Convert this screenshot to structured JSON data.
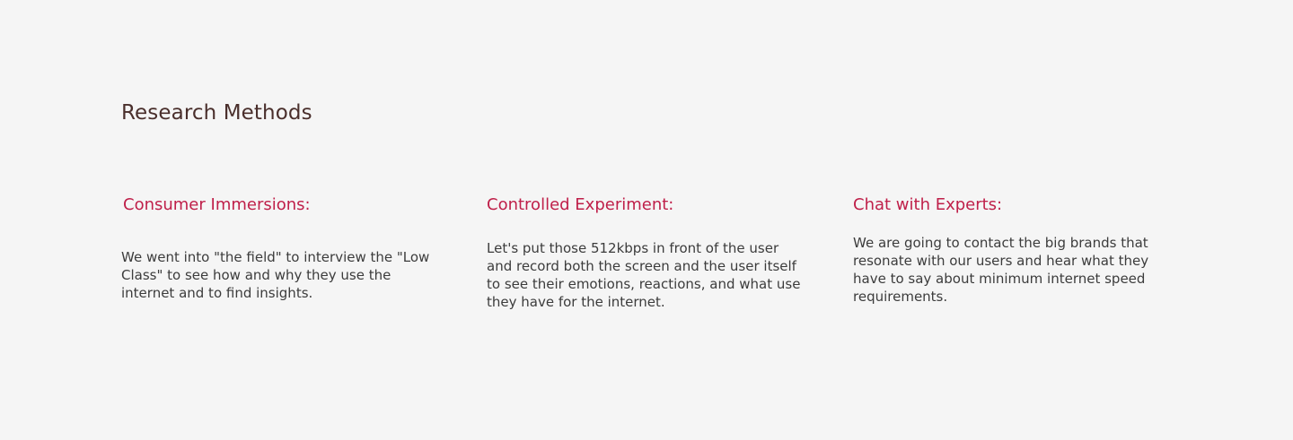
{
  "section": {
    "title": "Research Methods"
  },
  "methods": [
    {
      "heading": "Consumer Immersions:",
      "body": "We went into \"the field\" to interview the \"Low Class\" to see how and why they use the internet and to find insights."
    },
    {
      "heading": "Controlled Experiment:",
      "body": "Let's put those 512kbps in front of the user and record both the screen and the user itself to see their emotions, reactions, and what use they have for the internet."
    },
    {
      "heading": "Chat with Experts:",
      "body": "We are going to contact the big brands that resonate with our users and hear what they have to say about minimum internet speed requirements."
    }
  ],
  "colors": {
    "background": "#f5f5f5",
    "title": "#4a2f2c",
    "heading_accent": "#bf1f49",
    "body_text": "#3c3c3c"
  }
}
